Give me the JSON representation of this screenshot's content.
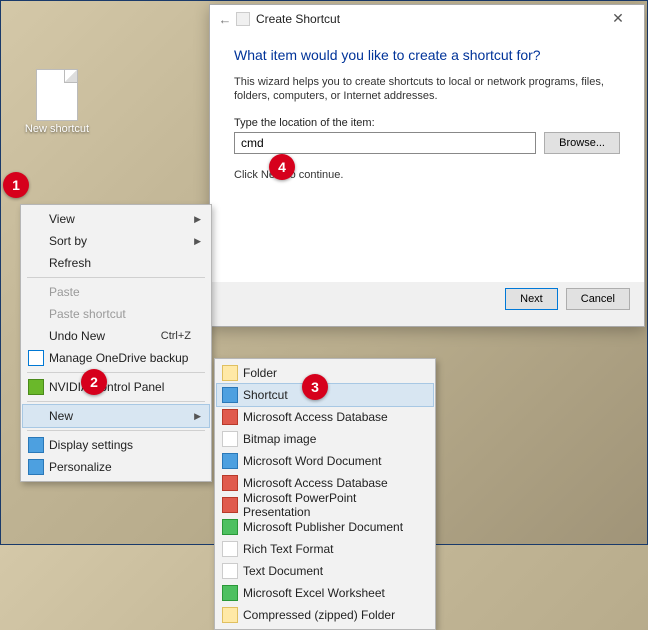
{
  "desktop": {
    "icon_label": "New shortcut"
  },
  "dialog": {
    "title": "Create Shortcut",
    "back_arrow": "←",
    "close": "✕",
    "heading": "What item would you like to create a shortcut for?",
    "description": "This wizard helps you to create shortcuts to local or network programs, files, folders, computers, or Internet addresses.",
    "location_label": "Type the location of the item:",
    "location_value": "cmd",
    "browse": "Browse...",
    "continue_text": "Click Next to continue.",
    "next": "Next",
    "cancel": "Cancel"
  },
  "context_main": {
    "items": [
      {
        "label": "View",
        "submenu": true
      },
      {
        "label": "Sort by",
        "submenu": true
      },
      {
        "label": "Refresh"
      }
    ],
    "items2": [
      {
        "label": "Paste",
        "disabled": true
      },
      {
        "label": "Paste shortcut",
        "disabled": true
      },
      {
        "label": "Undo New",
        "shortcut": "Ctrl+Z"
      },
      {
        "label": "Manage OneDrive backup",
        "icon": "od"
      }
    ],
    "items3": [
      {
        "label": "NVIDIA Control Panel",
        "icon": "nv"
      }
    ],
    "items4": [
      {
        "label": "New",
        "submenu": true,
        "selected": true
      }
    ],
    "items5": [
      {
        "label": "Display settings",
        "icon": "blue"
      },
      {
        "label": "Personalize",
        "icon": "blue"
      }
    ]
  },
  "context_sub": {
    "items": [
      {
        "label": "Folder",
        "icon": "folder"
      },
      {
        "label": "Shortcut",
        "icon": "blue",
        "selected": true
      },
      {
        "label": "Microsoft Access Database",
        "icon": "red"
      },
      {
        "label": "Bitmap image",
        "icon": ""
      },
      {
        "label": "Microsoft Word Document",
        "icon": "blue"
      },
      {
        "label": "Microsoft Access Database",
        "icon": "red"
      },
      {
        "label": "Microsoft PowerPoint Presentation",
        "icon": "red"
      },
      {
        "label": "Microsoft Publisher Document",
        "icon": "green"
      },
      {
        "label": "Rich Text Format",
        "icon": ""
      },
      {
        "label": "Text Document",
        "icon": ""
      },
      {
        "label": "Microsoft Excel Worksheet",
        "icon": "green"
      },
      {
        "label": "Compressed (zipped) Folder",
        "icon": "folder"
      }
    ]
  },
  "callouts": {
    "c1": "1",
    "c2": "2",
    "c3": "3",
    "c4": "4"
  }
}
